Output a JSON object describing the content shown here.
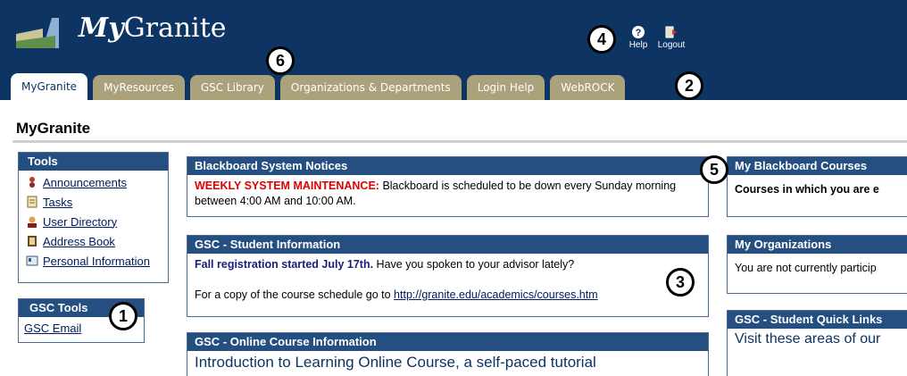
{
  "header": {
    "logo_text": "Granite",
    "logo_my": "My",
    "help_label": "Help",
    "logout_label": "Logout"
  },
  "tabs": [
    {
      "label": "MyGranite",
      "active": true
    },
    {
      "label": "MyResources"
    },
    {
      "label": "GSC Library"
    },
    {
      "label": "Organizations & Departments"
    },
    {
      "label": "Login Help"
    },
    {
      "label": "WebROCK"
    }
  ],
  "page_title": "MyGranite",
  "tools": {
    "title": "Tools",
    "items": [
      {
        "label": "Announcements",
        "icon": "announcements-icon"
      },
      {
        "label": "Tasks",
        "icon": "tasks-icon"
      },
      {
        "label": "User Directory",
        "icon": "user-directory-icon"
      },
      {
        "label": "Address Book",
        "icon": "address-book-icon"
      },
      {
        "label": "Personal Information",
        "icon": "personal-information-icon"
      }
    ]
  },
  "gsc_tools": {
    "title": "GSC Tools",
    "link": "GSC Email"
  },
  "notices": {
    "title": "Blackboard System Notices",
    "alert": "WEEKLY SYSTEM MAINTENANCE:",
    "text": " Blackboard is scheduled to be down every Sunday morning between 4:00 AM and 10:00 AM."
  },
  "student_info": {
    "title": "GSC - Student Information",
    "highlight": "Fall registration started July 17th.",
    "text": " Have you spoken to your advisor lately?",
    "schedule_text": "For a copy of the course schedule go to ",
    "schedule_link": "http://granite.edu/academics/courses.htm"
  },
  "online_course": {
    "title": "GSC - Online Course Information",
    "link": "Introduction to Learning Online Course, a self-paced tutorial"
  },
  "my_bb": {
    "title": "My Blackboard Courses",
    "text": "Courses in which you are e"
  },
  "my_orgs": {
    "title": "My Organizations",
    "text": "You are not currently particip"
  },
  "quick_links": {
    "title": "GSC - Student Quick Links",
    "text": "Visit these areas of our"
  },
  "callouts": [
    "1",
    "2",
    "3",
    "4",
    "5",
    "6"
  ],
  "colors": {
    "header_bg": "#0e3463",
    "tab_bg": "#a9a27b",
    "panel_head": "#244f80",
    "alert_red": "#e00000"
  }
}
